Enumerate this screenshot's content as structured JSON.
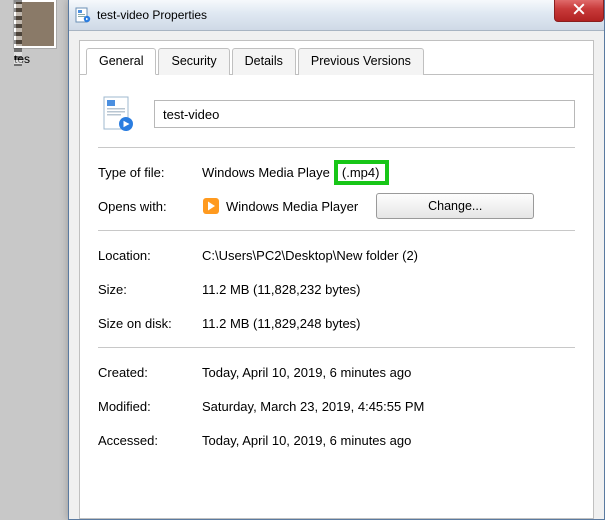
{
  "desktop_file_label": "tes",
  "window": {
    "title": "test-video Properties"
  },
  "tabs": [
    "General",
    "Security",
    "Details",
    "Previous Versions"
  ],
  "active_tab": 0,
  "filename": "test-video",
  "fields": {
    "type_label": "Type of file:",
    "type_value": "Windows Media Playe",
    "type_ext": "(.mp4)",
    "opens_label": "Opens with:",
    "opens_value": "Windows Media Player",
    "change_btn": "Change...",
    "location_label": "Location:",
    "location_value": "C:\\Users\\PC2\\Desktop\\New folder (2)",
    "size_label": "Size:",
    "size_value": "11.2 MB (11,828,232 bytes)",
    "sod_label": "Size on disk:",
    "sod_value": "11.2 MB (11,829,248 bytes)",
    "created_label": "Created:",
    "created_value": "Today, April 10, 2019, 6 minutes ago",
    "modified_label": "Modified:",
    "modified_value": "Saturday, March 23, 2019, 4:45:55 PM",
    "accessed_label": "Accessed:",
    "accessed_value": "Today, April 10, 2019, 6 minutes ago"
  }
}
